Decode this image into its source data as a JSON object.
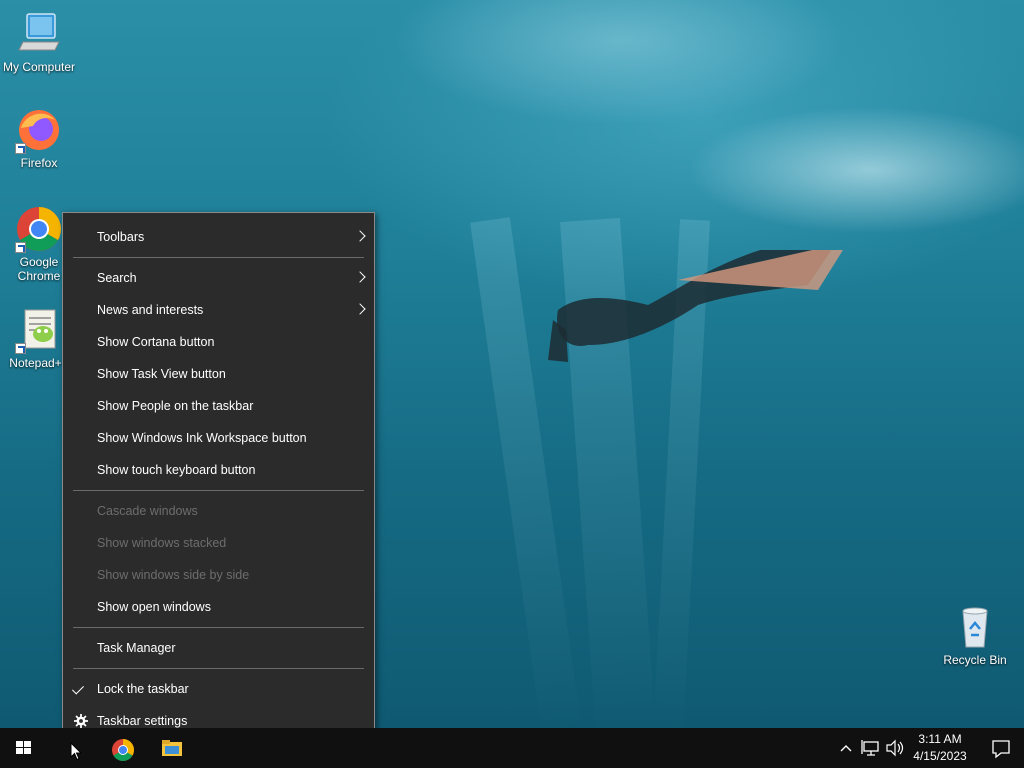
{
  "desktop": {
    "icons": [
      {
        "label": "My Computer"
      },
      {
        "label": "Firefox"
      },
      {
        "label": "Google Chrome"
      },
      {
        "label": "Notepad++"
      },
      {
        "label": "Recycle Bin"
      }
    ]
  },
  "context_menu": {
    "items": [
      {
        "label": "Toolbars",
        "submenu": true
      },
      {
        "label": "Search",
        "submenu": true
      },
      {
        "label": "News and interests",
        "submenu": true
      },
      {
        "label": "Show Cortana button"
      },
      {
        "label": "Show Task View button"
      },
      {
        "label": "Show People on the taskbar"
      },
      {
        "label": "Show Windows Ink Workspace button"
      },
      {
        "label": "Show touch keyboard button"
      },
      {
        "label": "Cascade windows",
        "disabled": true
      },
      {
        "label": "Show windows stacked",
        "disabled": true
      },
      {
        "label": "Show windows side by side",
        "disabled": true
      },
      {
        "label": "Show open windows"
      },
      {
        "label": "Task Manager"
      },
      {
        "label": "Lock the taskbar",
        "checked": true
      },
      {
        "label": "Taskbar settings",
        "icon": "gear-icon"
      }
    ]
  },
  "taskbar": {
    "time": "3:11 AM",
    "date": "4/15/2023",
    "icons": [
      "windows-start-icon",
      "chrome-icon",
      "file-explorer-icon",
      "chevron-up-icon",
      "network-icon",
      "volume-icon",
      "notification-icon"
    ]
  },
  "colors": {
    "menu_bg": "#2b2b2b",
    "taskbar_bg": "#101010",
    "disabled_text": "#6d6d6d"
  }
}
